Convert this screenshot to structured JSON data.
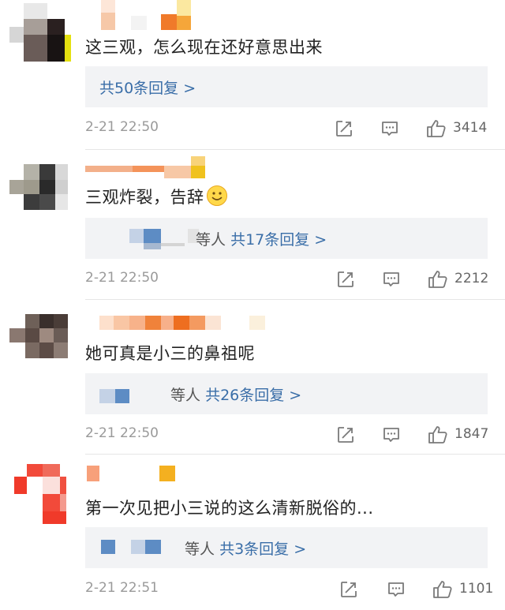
{
  "comments": [
    {
      "text": "这三观，怎么现在还好意思出来",
      "replies": {
        "others_label": "",
        "link": "共50条回复 >"
      },
      "time": "2-21 22:50",
      "likes": "3414"
    },
    {
      "text": "三观炸裂，告辞",
      "emoji": "🙂",
      "replies": {
        "others_label": "等人",
        "link": "共17条回复 >"
      },
      "time": "2-21 22:50",
      "likes": "2212"
    },
    {
      "text": "她可真是小三的鼻祖呢",
      "replies": {
        "others_label": "等人",
        "link": "共26条回复 >"
      },
      "time": "2-21 22:50",
      "likes": "1847"
    },
    {
      "text": "第一次见把小三说的这么清新脱俗的...",
      "replies": {
        "others_label": "等人",
        "link": "共3条回复 >"
      },
      "time": "2-21 22:51",
      "likes": "1101"
    }
  ],
  "icons": {
    "share": "share-icon",
    "reply": "comment-icon",
    "like": "thumbs-up-icon"
  },
  "colors": {
    "link": "#3a6ea8",
    "time": "#9a9a9a",
    "reply_bg": "#f2f3f5"
  }
}
